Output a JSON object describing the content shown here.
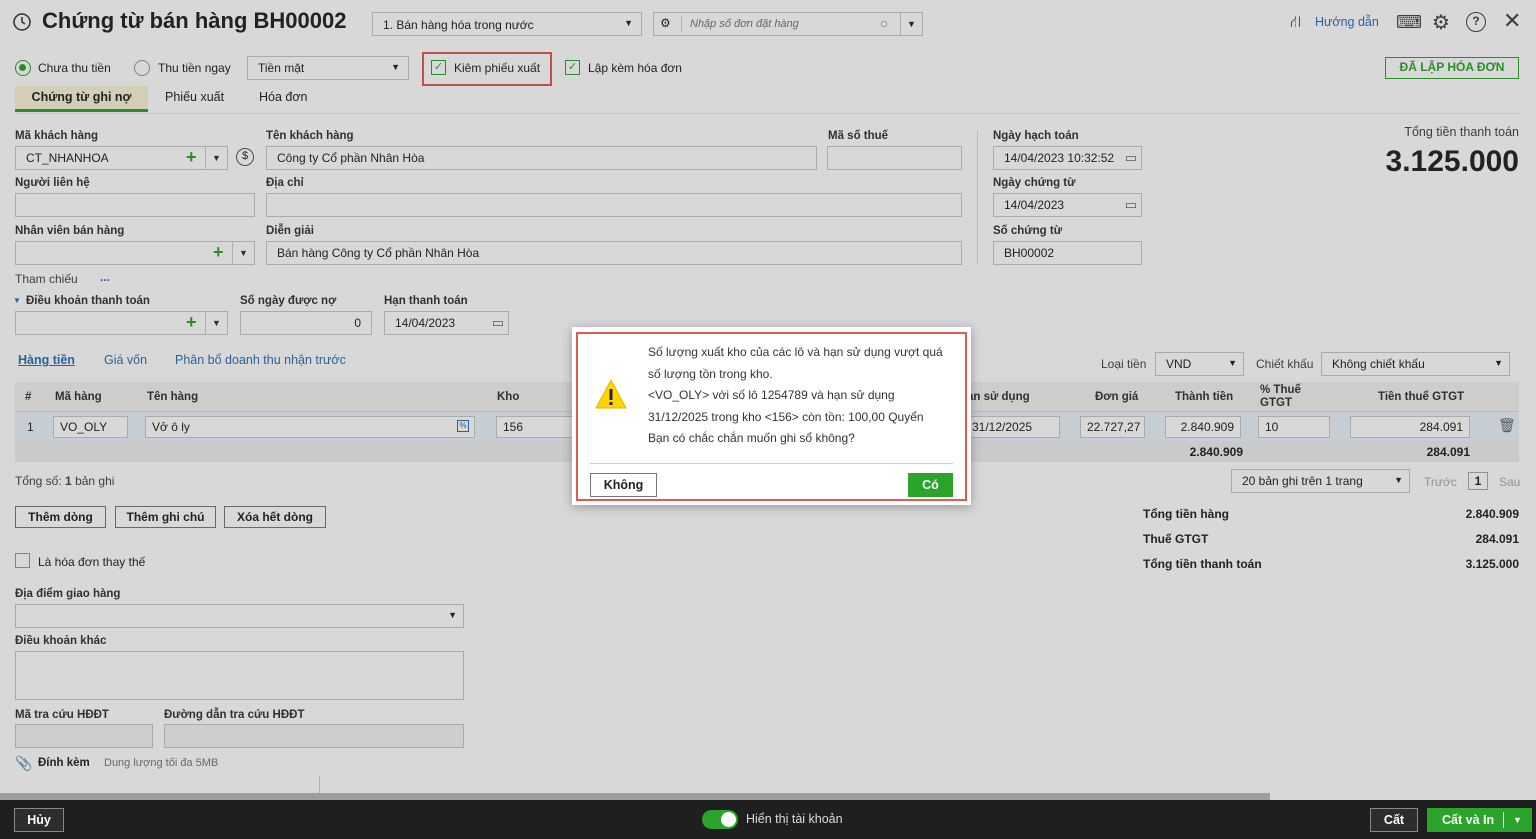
{
  "header": {
    "title": "Chứng từ bán hàng BH00002",
    "sale_type": "1. Bán hàng hóa trong nước",
    "order_placeholder": "Nhập số đơn đặt hàng",
    "guide_label": "Hướng dẫn"
  },
  "payment": {
    "option_unpaid": "Chưa thu tiền",
    "option_paid": "Thu tiền ngay",
    "method": "Tiền mặt",
    "check_export": "Kiêm phiếu xuất",
    "check_invoice": "Lập kèm hóa đơn",
    "invoice_status": "ĐÃ LẬP HÓA ĐƠN"
  },
  "tabs": [
    "Chứng từ ghi nợ",
    "Phiếu xuất",
    "Hóa đơn"
  ],
  "form": {
    "customer_code_label": "Mã khách hàng",
    "customer_code": "CT_NHANHOA",
    "customer_name_label": "Tên khách hàng",
    "customer_name": "Công ty Cổ phần Nhân Hòa",
    "tax_code_label": "Mã số thuế",
    "tax_code": "",
    "posting_date_label": "Ngày hạch toán",
    "posting_date": "14/04/2023 10:32:52",
    "contact_label": "Người liên hệ",
    "address_label": "Địa chỉ",
    "doc_date_label": "Ngày chứng từ",
    "doc_date": "14/04/2023",
    "staff_label": "Nhân viên bán hàng",
    "description_label": "Diễn giải",
    "description": "Bán hàng Công ty Cổ phần Nhân Hòa",
    "doc_no_label": "Số chứng từ",
    "doc_no": "BH00002",
    "reference_label": "Tham chiếu",
    "reference_more": "...",
    "payment_terms_label": "Điều khoản thanh toán",
    "credit_days_label": "Số ngày được nợ",
    "credit_days": "0",
    "due_date_label": "Hạn thanh toán",
    "due_date": "14/04/2023"
  },
  "total_box": {
    "label": "Tổng tiền thanh toán",
    "value": "3.125.000"
  },
  "subtabs": [
    "Hàng tiền",
    "Giá vốn",
    "Phân bổ doanh thu nhận trước"
  ],
  "currency": {
    "label": "Loại tiền",
    "value": "VND",
    "discount_label": "Chiết khấu",
    "discount_value": "Không chiết khấu"
  },
  "table": {
    "headers": [
      "#",
      "Mã hàng",
      "Tên hàng",
      "Kho",
      "ạn sử dụng",
      "Đơn giá",
      "Thành tiền",
      "% Thuế GTGT",
      "Tiền thuế GTGT"
    ],
    "row": {
      "index": "1",
      "code": "VO_OLY",
      "name": "Vở ô ly",
      "warehouse": "156",
      "expiry": "31/12/2025",
      "price": "22.727,27",
      "amount": "2.840.909",
      "vat_rate": "10",
      "vat_amount": "284.091"
    },
    "total_amount": "2.840.909",
    "total_vat": "284.091",
    "record_count_label": "Tổng số:",
    "record_count": "1",
    "record_count_suffix": "bản ghi",
    "page_size": "20 bản ghi trên 1 trang",
    "prev": "Trước",
    "page": "1",
    "next": "Sau"
  },
  "row_buttons": [
    "Thêm dòng",
    "Thêm ghi chú",
    "Xóa hết dòng"
  ],
  "summary": {
    "goods_label": "Tổng tiền hàng",
    "goods": "2.840.909",
    "vat_label": "Thuế GTGT",
    "vat": "284.091",
    "total_label": "Tổng tiền thanh toán",
    "total": "3.125.000"
  },
  "extra": {
    "replacement_invoice": "Là hóa đơn thay thế",
    "delivery_label": "Địa điểm giao hàng",
    "other_terms_label": "Điều khoản khác",
    "lookup_code_label": "Mã tra cứu HĐĐT",
    "lookup_url_label": "Đường dẫn tra cứu HĐĐT",
    "attach_label": "Đính kèm",
    "attach_hint": "Dung lượng tối đa 5MB"
  },
  "footer": {
    "cancel": "Hủy",
    "show_accounts": "Hiển thị tài khoản",
    "save": "Cất",
    "save_print": "Cất và In"
  },
  "dialog": {
    "line1": "Số lượng xuất kho của các lô và hạn sử dụng vượt quá",
    "line2": "số lượng tồn trong kho.",
    "line3": "<VO_OLY> với số lô 1254789 và hạn sử dụng",
    "line4": "31/12/2025 trong kho <156> còn tồn: 100,00 Quyển",
    "line5": "Bạn có chắc chắn muốn ghi sổ không?",
    "no": "Không",
    "yes": "Có"
  },
  "colors": {
    "accent_green": "#2ba42b",
    "highlight_red": "#e05a52",
    "link_blue": "#2c6fb5"
  }
}
